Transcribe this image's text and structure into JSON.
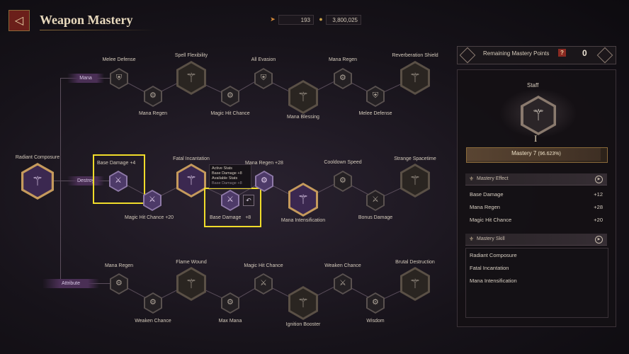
{
  "header": {
    "title": "Weapon Mastery",
    "currency_a": "193",
    "currency_b": "3,800,025",
    "back_icon": "back-arrow-icon",
    "currency_a_icon": "arrow-token-icon",
    "currency_b_icon": "gold-coin-icon"
  },
  "tree": {
    "root_label": "Radiant Composure",
    "branches": {
      "mana": "Mana",
      "destroy": "Destroy",
      "attribute": "Attribute"
    },
    "mana_nodes": {
      "melee_defense_1": "Melee Defense",
      "spell_flexibility": "Spell Flexibility",
      "all_evasion": "All Evasion",
      "mana_regen_top": "Mana Regen",
      "reverberation_shield": "Reverberation Shield",
      "mana_regen_low": "Mana Regen",
      "magic_hit_chance": "Magic Hit Chance",
      "mana_blessing": "Mana Blessing",
      "melee_defense_2": "Melee Defense"
    },
    "destroy_nodes": {
      "base_damage": "Base Damage",
      "base_damage_value": "+4",
      "fatal_incantation": "Fatal Incantation",
      "mana_regen": "Mana Regen",
      "mana_regen_value": "+28",
      "cooldown_speed": "Cooldown Speed",
      "strange_spacetime": "Strange Spacetime",
      "magic_hit_chance": "Magic Hit Chance",
      "magic_hit_chance_value": "+20",
      "base_damage_2": "Base Damage",
      "base_damage_2_value": "+8",
      "mana_intensification": "Mana Intensification",
      "bonus_damage": "Bonus Damage"
    },
    "tooltip": {
      "line1": "Active Stats",
      "line2": "Base Damage",
      "line2_val": "+8",
      "line3": "Available Stats",
      "line4": "Base Damage",
      "line4_val": "+8"
    },
    "attribute_nodes": {
      "mana_regen": "Mana Regen",
      "flame_wound": "Flame Wound",
      "magic_hit_chance": "Magic Hit Chance",
      "weaken_chance_top": "Weaken Chance",
      "brutal_destruction": "Brutal Destruction",
      "weaken_chance_low": "Weaken Chance",
      "max_mana": "Max Mana",
      "ignition_booster": "Ignition Booster",
      "wisdom": "Wisdom"
    }
  },
  "panel": {
    "points_label": "Remaining Mastery Points",
    "points_help": "?",
    "points_value": "0",
    "weapon_name": "Staff",
    "weapon_rank": "I",
    "mastery_label": "Mastery 7",
    "mastery_percent": "(96.623%)",
    "mastery_progress": 0.96623,
    "effect_header": "Mastery Effect",
    "effects": [
      {
        "name": "Base Damage",
        "value": "+12"
      },
      {
        "name": "Mana Regen",
        "value": "+28"
      },
      {
        "name": "Magic Hit Chance",
        "value": "+20"
      }
    ],
    "skill_header": "Mastery Skill",
    "skills": [
      "Radiant Composure",
      "Fatal Incantation",
      "Mana Intensification"
    ]
  },
  "colors": {
    "highlight": "#f0dc2a",
    "active_node": "#4d3a68",
    "accent_gold": "#c59a5c"
  }
}
